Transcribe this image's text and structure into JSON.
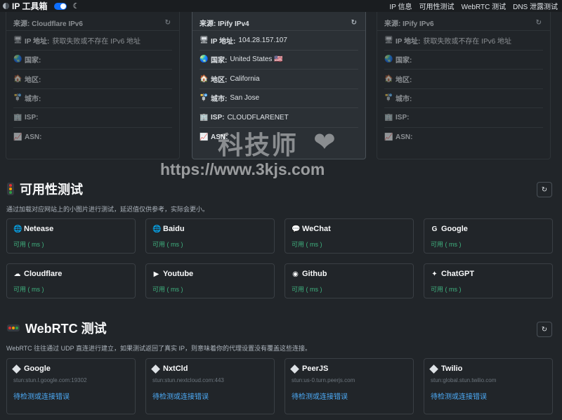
{
  "navbar": {
    "brand": "IP 工具箱",
    "links": [
      "IP 信息",
      "可用性测试",
      "WebRTC 测试",
      "DNS 泄露测试"
    ]
  },
  "ip_cards": [
    {
      "source": "来源: Cloudflare IPv6",
      "rows": [
        {
          "icon": "🖥",
          "label": "IP 地址:",
          "value": "获取失败或不存在 IPv6 地址"
        },
        {
          "icon": "🌏",
          "label": "国家:",
          "value": ""
        },
        {
          "icon": "🏠",
          "label": "地区:",
          "value": ""
        },
        {
          "icon": "🚏",
          "label": "城市:",
          "value": ""
        },
        {
          "icon": "🏢",
          "label": "ISP:",
          "value": ""
        },
        {
          "icon": "📈",
          "label": "ASN:",
          "value": ""
        }
      ]
    },
    {
      "source": "来源: IPify IPv4",
      "rows": [
        {
          "icon": "🖥",
          "label": "IP 地址:",
          "value": "104.28.157.107"
        },
        {
          "icon": "🌏",
          "label": "国家:",
          "value": "United States 🇺🇸"
        },
        {
          "icon": "🏠",
          "label": "地区:",
          "value": "California"
        },
        {
          "icon": "🚏",
          "label": "城市:",
          "value": "San Jose"
        },
        {
          "icon": "🏢",
          "label": "ISP:",
          "value": "CLOUDFLARENET"
        },
        {
          "icon": "📈",
          "label": "ASN:",
          "value": ""
        }
      ]
    },
    {
      "source": "来源: IPify IPv6",
      "rows": [
        {
          "icon": "🖥",
          "label": "IP 地址:",
          "value": "获取失败或不存在 IPv6 地址"
        },
        {
          "icon": "🌏",
          "label": "国家:",
          "value": ""
        },
        {
          "icon": "🏠",
          "label": "地区:",
          "value": ""
        },
        {
          "icon": "🚏",
          "label": "城市:",
          "value": ""
        },
        {
          "icon": "🏢",
          "label": "ISP:",
          "value": ""
        },
        {
          "icon": "📈",
          "label": "ASN:",
          "value": ""
        }
      ]
    }
  ],
  "availability": {
    "title": "可用性测试",
    "description": "通过加载对应网站上的小图片进行测试，延迟值仅供参考，实际会更小。",
    "refresh_icon": "↻",
    "items": [
      {
        "name": "Netease",
        "icon": "🌐",
        "status": "可用 ( ms )"
      },
      {
        "name": "Baidu",
        "icon": "🌐",
        "status": "可用 ( ms )"
      },
      {
        "name": "WeChat",
        "icon": "💬",
        "status": "可用 ( ms )"
      },
      {
        "name": "Google",
        "icon": "G",
        "status": "可用 ( ms )"
      },
      {
        "name": "Cloudflare",
        "icon": "☁",
        "status": "可用 ( ms )"
      },
      {
        "name": "Youtube",
        "icon": "▶",
        "status": "可用 ( ms )"
      },
      {
        "name": "Github",
        "icon": "◉",
        "status": "可用 ( ms )"
      },
      {
        "name": "ChatGPT",
        "icon": "✦",
        "status": "可用 ( ms )"
      }
    ]
  },
  "webrtc": {
    "title": "WebRTC 测试",
    "description": "WebRTC 往往通过 UDP 直连进行建立，如果测试返回了真实 IP，则意味着你的代理设置没有覆盖这些连接。",
    "refresh_icon": "↻",
    "items": [
      {
        "name": "Google",
        "stun": "stun:stun.l.google.com:19302",
        "status": "待检测或连接错误"
      },
      {
        "name": "NxtCld",
        "stun": "stun:stun.nextcloud.com:443",
        "status": "待检测或连接错误"
      },
      {
        "name": "PeerJS",
        "stun": "stun:us-0.turn.peerjs.com",
        "status": "待检测或连接错误"
      },
      {
        "name": "Twilio",
        "stun": "stun:global.stun.twilio.com",
        "status": "待检测或连接错误"
      }
    ]
  },
  "watermark": {
    "text": "科技师",
    "heart": "❤",
    "url": "https://www.3kjs.com"
  }
}
